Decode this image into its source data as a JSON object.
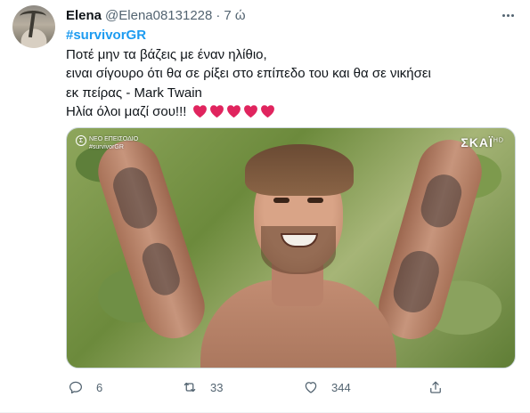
{
  "tweet": {
    "display_name": "Elena",
    "handle": "@Elena08131228",
    "separator": "·",
    "time": "7 ώ",
    "hashtag": "#survivorGR",
    "lines": [
      "Ποτέ μην τα βάζεις με έναν ηλίθιο,",
      "ειναι σίγουρο ότι θα σε ρίξει στο επίπεδο του και θα σε νικήσει",
      "εκ πείρας - Mark Twain",
      "Ηλία όλοι μαζί σου!!!"
    ],
    "heart_emoji_count": 5,
    "heart_color": "#e0245e"
  },
  "media": {
    "overlay_left_badge": "Σ",
    "overlay_left_line1": "ΝΕΟ ΕΠΕΙΣΟΔΙΟ",
    "overlay_left_line2": "#survivorGR",
    "overlay_right_logo": "ΣΚΑΪ",
    "overlay_right_suffix": "HD"
  },
  "actions": {
    "reply_count": "6",
    "retweet_count": "33",
    "like_count": "344",
    "icons": [
      "reply-icon",
      "retweet-icon",
      "like-icon",
      "share-icon"
    ]
  },
  "colors": {
    "accent": "#1d9bf0",
    "secondary_text": "#536471"
  }
}
